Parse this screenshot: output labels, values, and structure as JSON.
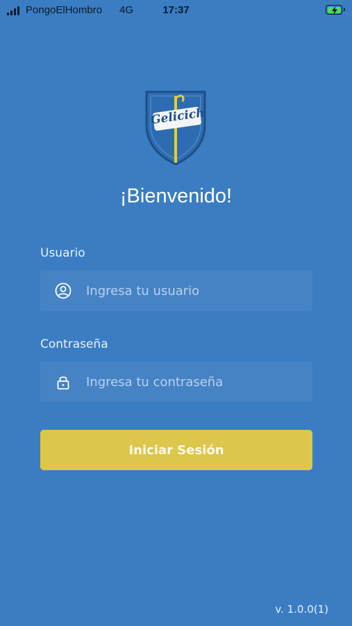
{
  "status_bar": {
    "carrier": "PongoElHombro",
    "network": "4G",
    "time": "17:37"
  },
  "logo": {
    "text": "Gelicich"
  },
  "login": {
    "welcome": "¡Bienvenido!",
    "username_label": "Usuario",
    "username_placeholder": "Ingresa tu usuario",
    "username_value": "",
    "password_label": "Contraseña",
    "password_placeholder": "Ingresa tu contraseña",
    "password_value": "",
    "submit_label": "Iniciar Sesión"
  },
  "footer": {
    "version": "v. 1.0.0(1)"
  },
  "colors": {
    "background": "#3b7dc2",
    "button": "#dcc64c",
    "battery": "#4cd964"
  },
  "icons": {
    "username": "user-circle-icon",
    "password": "lock-icon",
    "battery": "battery-charging-icon",
    "signal": "cellular-signal-icon"
  }
}
